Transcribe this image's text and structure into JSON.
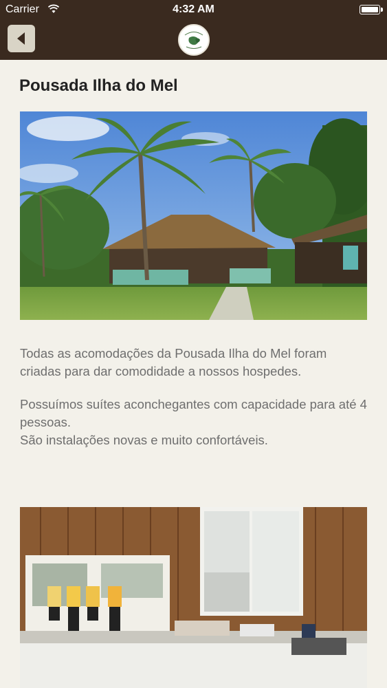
{
  "status_bar": {
    "carrier": "Carrier",
    "time": "4:32 AM",
    "wifi_icon": "wifi-icon",
    "battery_icon": "battery-icon"
  },
  "nav": {
    "back_icon": "chevron-left-icon",
    "logo": "pousada-logo",
    "bar_color": "#3a2a1f"
  },
  "page": {
    "title": "Pousada Ilha do Mel",
    "paragraph_1": "Todas as acomodações da Pousada Ilha do Mel foram criadas para dar comodidade a nossos hospedes.",
    "paragraph_2_line_1": "Possuímos suítes aconchegantes com capacidade para até 4 pessoas.",
    "paragraph_2_line_2": "São instalações novas e muito confortáveis."
  }
}
